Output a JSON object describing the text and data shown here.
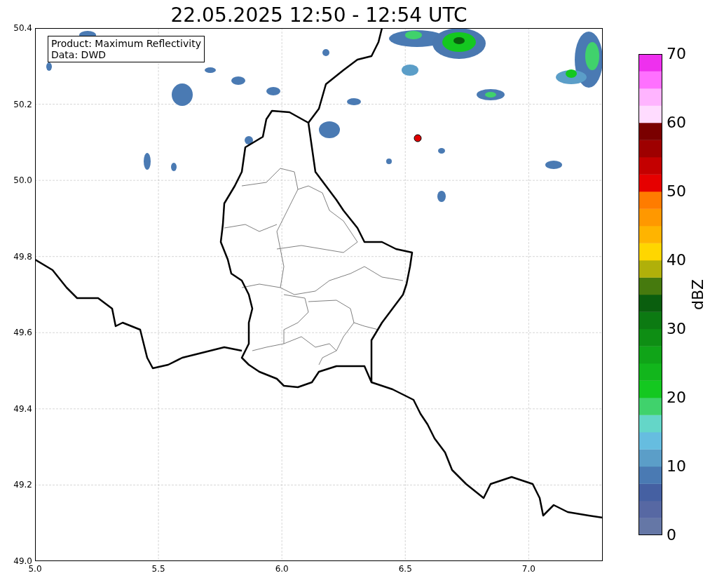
{
  "title": "22.05.2025 12:50 - 12:54 UTC",
  "info_box": [
    "Product: Maximum Reflectivity",
    "Data: DWD"
  ],
  "map": {
    "x_ticks": [
      "5.0",
      "5.5",
      "6.0",
      "6.5",
      "7.0"
    ],
    "y_ticks": [
      "50.4",
      "50.2",
      "50.0",
      "49.8",
      "49.6",
      "49.4",
      "49.2",
      "49.0"
    ]
  },
  "colorbar": {
    "label": "dBZ",
    "ticks": [
      "70",
      "60",
      "50",
      "40",
      "30",
      "20",
      "10",
      "0"
    ],
    "bins": [
      {
        "color": "#6577a6"
      },
      {
        "color": "#5768a3"
      },
      {
        "color": "#4560a2"
      },
      {
        "color": "#4a7ab3"
      },
      {
        "color": "#5b9ec8"
      },
      {
        "color": "#66bde0"
      },
      {
        "color": "#64d6c8"
      },
      {
        "color": "#40d26c"
      },
      {
        "color": "#14c820"
      },
      {
        "color": "#12b61c"
      },
      {
        "color": "#10a418"
      },
      {
        "color": "#0e8e14"
      },
      {
        "color": "#0c7a12"
      },
      {
        "color": "#0a5e0e"
      },
      {
        "color": "#467a0e"
      },
      {
        "color": "#b0b00a"
      },
      {
        "color": "#ffd600"
      },
      {
        "color": "#ffb400"
      },
      {
        "color": "#ff9800"
      },
      {
        "color": "#ff7c00"
      },
      {
        "color": "#e60000"
      },
      {
        "color": "#c40000"
      },
      {
        "color": "#9e0000"
      },
      {
        "color": "#7a0000"
      },
      {
        "color": "#ffdcff"
      },
      {
        "color": "#ffb4ff"
      },
      {
        "color": "#ff70ff"
      },
      {
        "color": "#ee30ee"
      }
    ]
  }
}
